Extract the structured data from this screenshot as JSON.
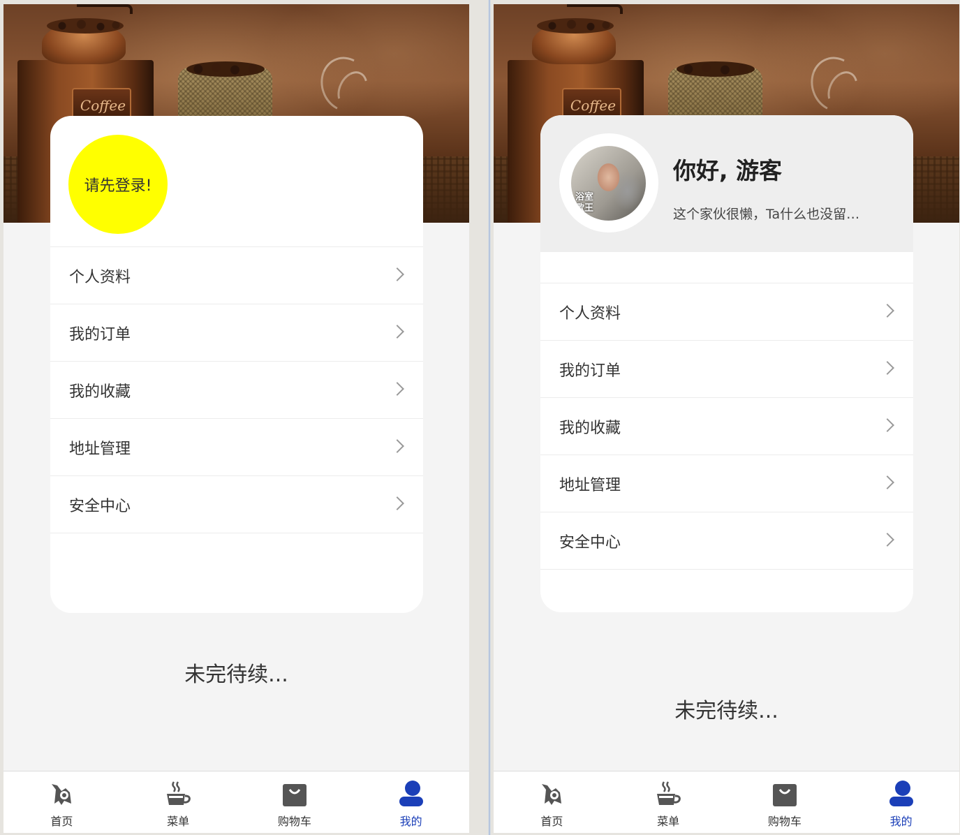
{
  "screens": [
    {
      "id": "logged-out",
      "login_prompt": "请先登录!",
      "menu": [
        {
          "label": "个人资料"
        },
        {
          "label": "我的订单"
        },
        {
          "label": "我的收藏"
        },
        {
          "label": "地址管理"
        },
        {
          "label": "安全中心"
        }
      ],
      "to_be_continued": "未完待续...",
      "tabs": [
        {
          "label": "首页",
          "icon": "home-icon",
          "active": false
        },
        {
          "label": "菜单",
          "icon": "coffee-cup-icon",
          "active": false
        },
        {
          "label": "购物车",
          "icon": "shopping-bag-icon",
          "active": false
        },
        {
          "label": "我的",
          "icon": "user-icon",
          "active": true
        }
      ]
    },
    {
      "id": "guest",
      "greeting": "你好, 游客",
      "signature": "这个家伙很懒，Ta什么也没留…",
      "avatar_caption": "浴室\n歌王",
      "menu": [
        {
          "label": "个人资料"
        },
        {
          "label": "我的订单"
        },
        {
          "label": "我的收藏"
        },
        {
          "label": "地址管理"
        },
        {
          "label": "安全中心"
        }
      ],
      "to_be_continued": "未完待续...",
      "tabs": [
        {
          "label": "首页",
          "icon": "home-icon",
          "active": false
        },
        {
          "label": "菜单",
          "icon": "coffee-cup-icon",
          "active": false
        },
        {
          "label": "购物车",
          "icon": "shopping-bag-icon",
          "active": false
        },
        {
          "label": "我的",
          "icon": "user-icon",
          "active": true
        }
      ]
    }
  ],
  "header_photo_text": "Coffee",
  "colors": {
    "login_circle": "#ffff00",
    "active_tab": "#1b3fb8",
    "inactive_tab_icon": "#555555",
    "page_background": "#f4f4f4"
  }
}
